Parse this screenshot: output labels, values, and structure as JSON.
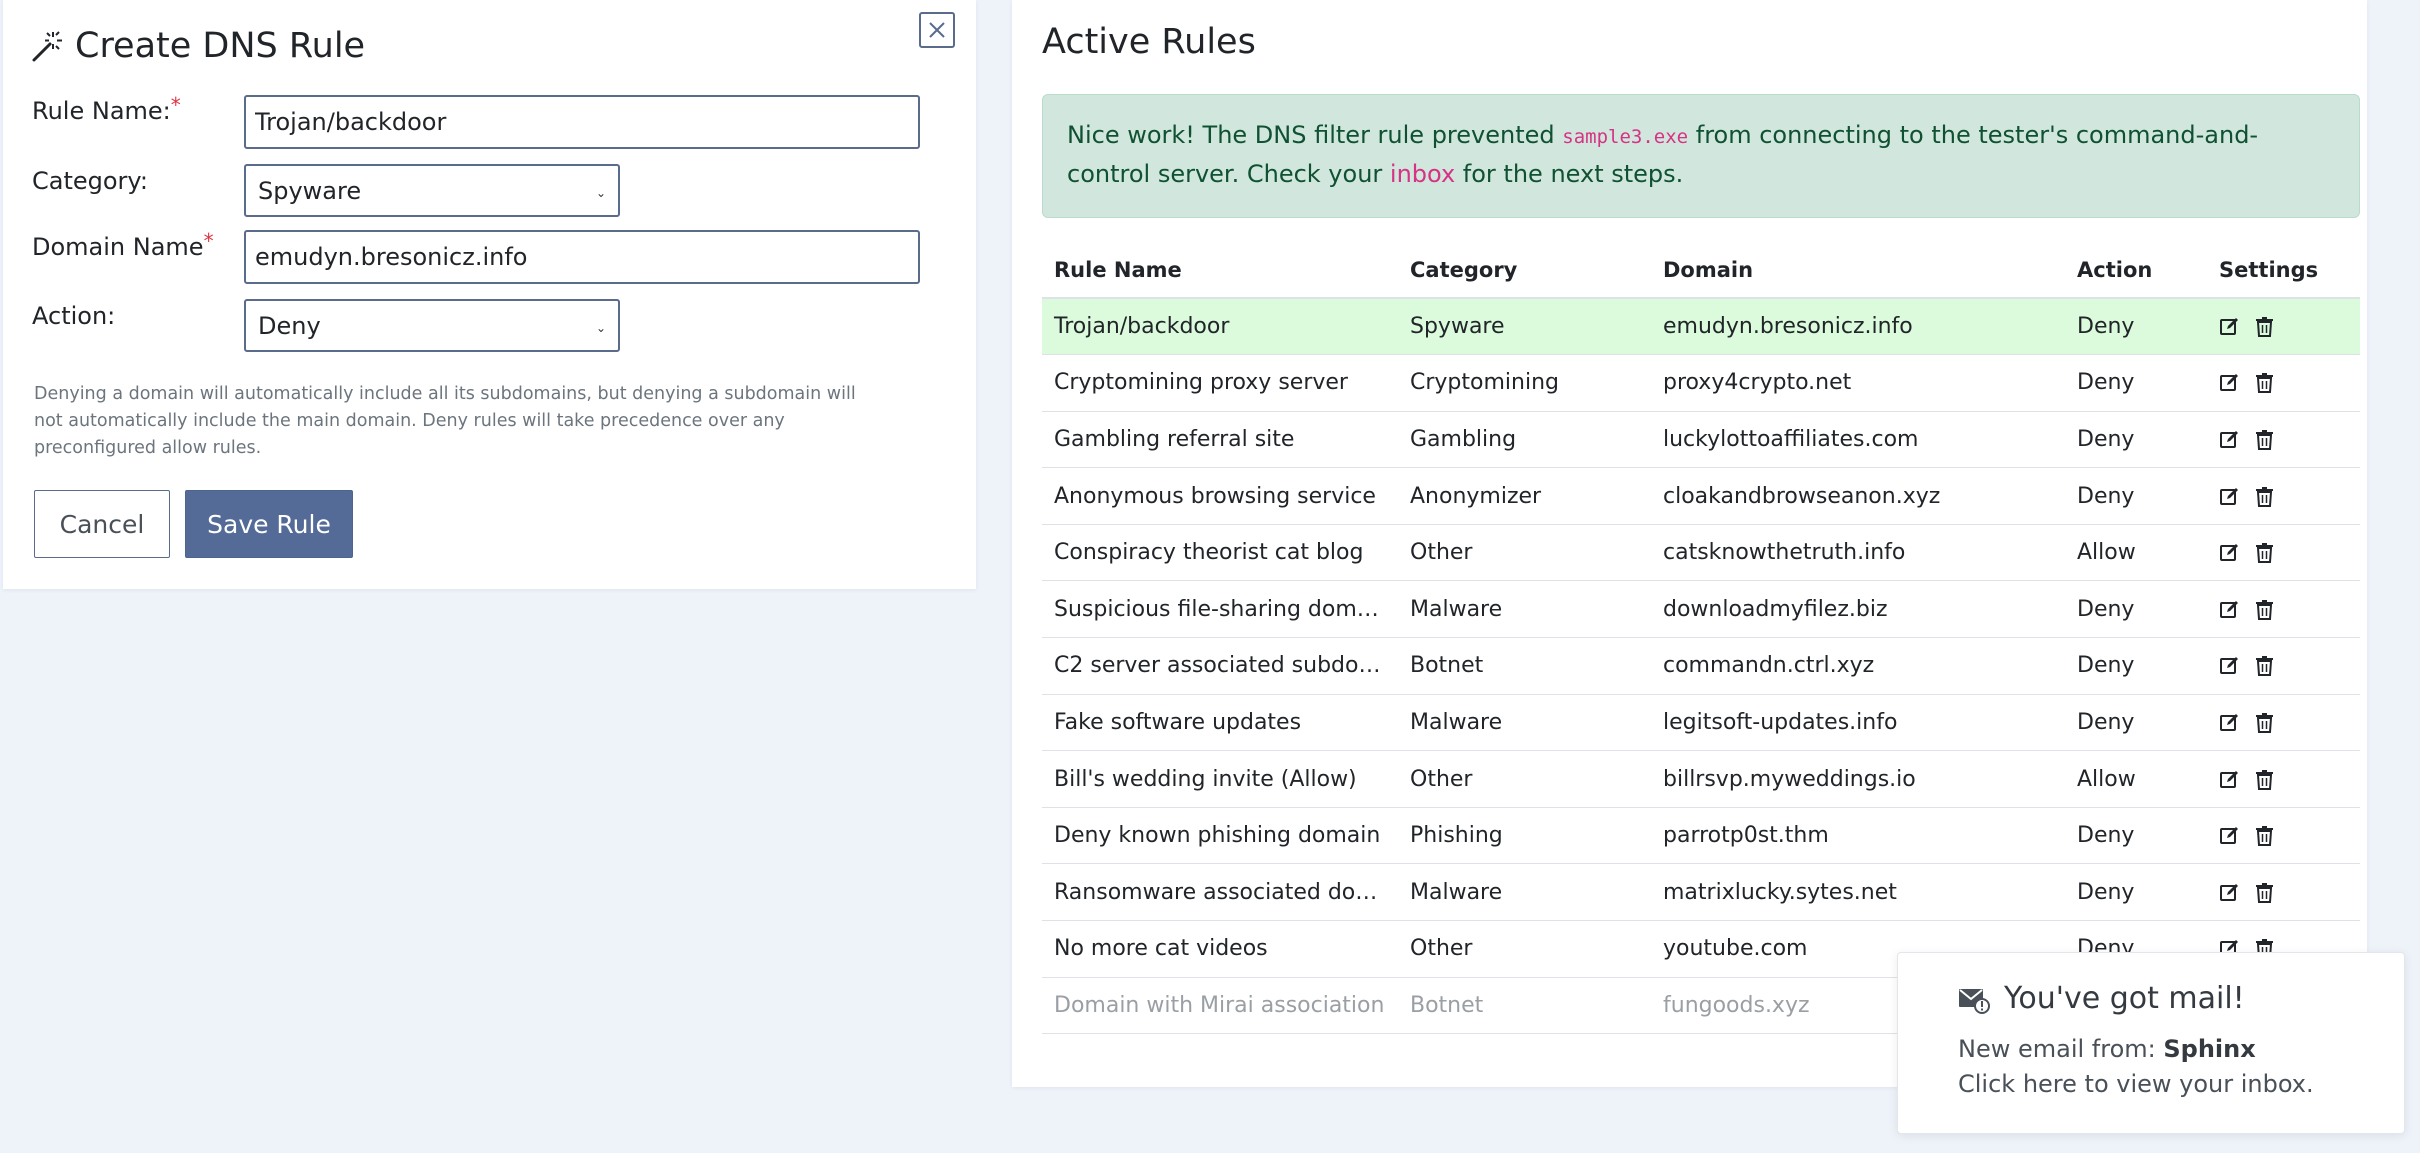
{
  "form": {
    "title": "Create DNS Rule",
    "rule_name_label": "Rule Name:",
    "rule_name_value": "Trojan/backdoor",
    "category_label": "Category:",
    "category_value": "Spyware",
    "domain_label": "Domain Name",
    "domain_value": "emudyn.bresonicz.info",
    "action_label": "Action:",
    "action_value": "Deny",
    "required_mark": "*",
    "help_text": "Denying a domain will automatically include all its subdomains, but denying a subdomain will not automatically include the main domain. Deny rules will take precedence over any preconfigured allow rules.",
    "cancel_label": "Cancel",
    "save_label": "Save Rule"
  },
  "rules_panel": {
    "title": "Active Rules",
    "alert": {
      "part1": "Nice work! The DNS filter rule prevented ",
      "code": "sample3.exe",
      "part2": " from connecting to the tester's command-and-control server. Check your ",
      "link": "inbox",
      "part3": " for the next steps."
    },
    "columns": [
      "Rule Name",
      "Category",
      "Domain",
      "Action",
      "Settings"
    ],
    "rows": [
      {
        "name": "Trojan/backdoor",
        "category": "Spyware",
        "domain": "emudyn.bresonicz.info",
        "action": "Deny"
      },
      {
        "name": "Cryptomining proxy server",
        "category": "Cryptomining",
        "domain": "proxy4crypto.net",
        "action": "Deny"
      },
      {
        "name": "Gambling referral site",
        "category": "Gambling",
        "domain": "luckylottoaffiliates.com",
        "action": "Deny"
      },
      {
        "name": "Anonymous browsing service",
        "category": "Anonymizer",
        "domain": "cloakandbrowseanon.xyz",
        "action": "Deny"
      },
      {
        "name": "Conspiracy theorist cat blog",
        "category": "Other",
        "domain": "catsknowthetruth.info",
        "action": "Allow"
      },
      {
        "name": "Suspicious file-sharing domain",
        "category": "Malware",
        "domain": "downloadmyfilez.biz",
        "action": "Deny"
      },
      {
        "name": "C2 server associated subdom...",
        "category": "Botnet",
        "domain": "commandn.ctrl.xyz",
        "action": "Deny"
      },
      {
        "name": "Fake software updates",
        "category": "Malware",
        "domain": "legitsoft-updates.info",
        "action": "Deny"
      },
      {
        "name": "Bill's wedding invite (Allow)",
        "category": "Other",
        "domain": "billrsvp.myweddings.io",
        "action": "Allow"
      },
      {
        "name": "Deny known phishing domain",
        "category": "Phishing",
        "domain": "parrotp0st.thm",
        "action": "Deny"
      },
      {
        "name": "Ransomware associated dom...",
        "category": "Malware",
        "domain": "matrixlucky.sytes.net",
        "action": "Deny"
      },
      {
        "name": "No more cat videos",
        "category": "Other",
        "domain": "youtube.com",
        "action": "Deny"
      },
      {
        "name": "Domain with Mirai association",
        "category": "Botnet",
        "domain": "fungoods.xyz",
        "action": ""
      }
    ]
  },
  "toast": {
    "title": "You've got mail!",
    "line1_prefix": "New email from: ",
    "sender": "Sphinx",
    "line2": "Click here to view your inbox."
  },
  "colors": {
    "accent": "#546b97",
    "alert_bg": "#d1e7dd",
    "highlight_row": "#dbfbdc",
    "link": "#d63384",
    "required": "#dc3545"
  }
}
